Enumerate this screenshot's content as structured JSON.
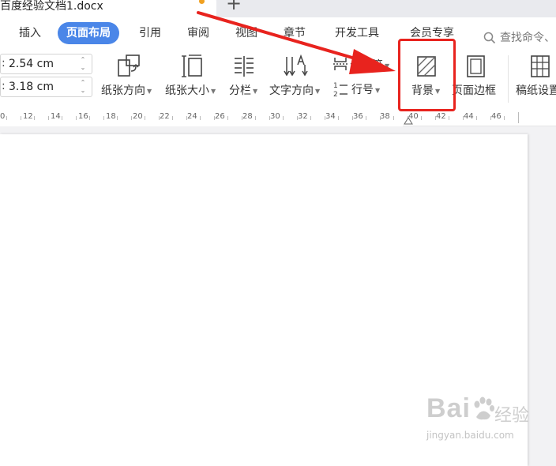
{
  "window": {
    "doc_title": "百度经验文档1.docx",
    "new_tab_glyph": "+"
  },
  "menu": {
    "tabs": [
      {
        "label": "插入",
        "active": false
      },
      {
        "label": "页面布局",
        "active": true
      },
      {
        "label": "引用",
        "active": false
      },
      {
        "label": "审阅",
        "active": false
      },
      {
        "label": "视图",
        "active": false
      },
      {
        "label": "章节",
        "active": false
      },
      {
        "label": "开发工具",
        "active": false
      },
      {
        "label": "会员专享",
        "active": false
      }
    ],
    "search_placeholder": "查找命令、"
  },
  "margins": {
    "top_value": "2.54 cm",
    "bottom_value": "3.18 cm"
  },
  "tools": {
    "orientation": "纸张方向",
    "size": "纸张大小",
    "columns": "分栏",
    "text_direction": "文字方向",
    "breaks": "分隔符",
    "line_numbers": "行号",
    "background": "背景",
    "page_border": "页面边框",
    "grid_paper": "稿纸设置"
  },
  "ruler": {
    "labels": [
      "0",
      "12",
      "14",
      "16",
      "18",
      "20",
      "22",
      "24",
      "26",
      "28",
      "30",
      "32",
      "34",
      "36",
      "38",
      "40",
      "42",
      "44",
      "46"
    ]
  },
  "watermark": {
    "brand": "Bai",
    "brand_cn": "经验",
    "url": "jingyan.baidu.com"
  },
  "colors": {
    "accent": "#4a86e8",
    "annotation_red": "#e8231e",
    "unsaved_dot": "#f0a020"
  }
}
